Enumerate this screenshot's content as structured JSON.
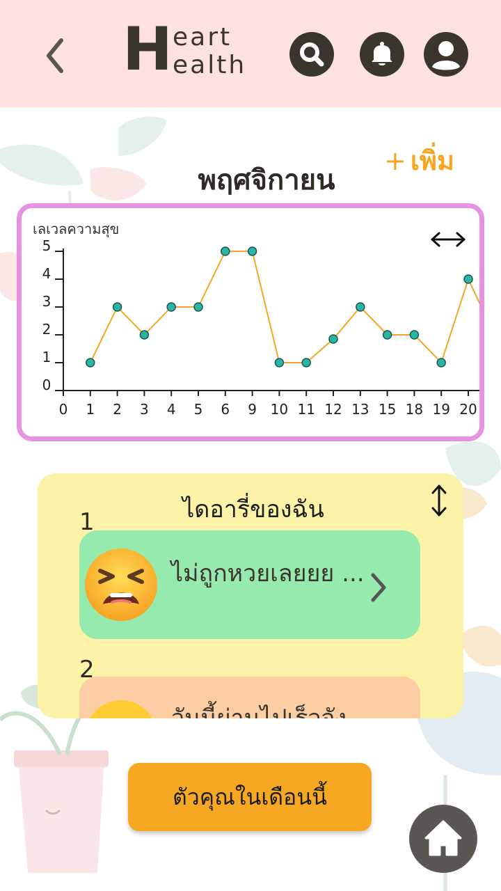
{
  "header": {
    "logo_letter": "H",
    "logo_word1": "eart",
    "logo_word2": "ealth",
    "icons": [
      "back-icon",
      "search-icon",
      "bell-icon",
      "user-icon"
    ]
  },
  "page": {
    "month": "พฤศจิกายน",
    "add_label": "เพิ่ม",
    "add_plus": "+"
  },
  "colors": {
    "header_bg": "#fde2dd",
    "accent": "#f7a623",
    "chart_border": "#e793e2",
    "line": "#f7a623",
    "point": "#2bb3a3",
    "diary_bg": "#fcf3a8",
    "entry1_bg": "#96eaae",
    "entry2_bg": "#fdcda4"
  },
  "chart_data": {
    "type": "line",
    "ylabel": "เลเวลความสุข",
    "x_ticks": [
      "0",
      "1",
      "2",
      "3",
      "4",
      "5",
      "6",
      "9",
      "10",
      "11",
      "12",
      "13",
      "15",
      "18",
      "19",
      "20"
    ],
    "y_ticks": [
      "0",
      "1",
      "2",
      "3",
      "4",
      "5"
    ],
    "ylim": [
      0,
      5
    ],
    "series": [
      {
        "x": [
          "1",
          "2",
          "3",
          "4",
          "5",
          "6",
          "9",
          "10",
          "11",
          "12",
          "13",
          "15",
          "18",
          "19",
          "20"
        ],
        "values": [
          1,
          3,
          2,
          3,
          3,
          5,
          5,
          1,
          1,
          1.85,
          3,
          2,
          2,
          1,
          4
        ]
      }
    ],
    "grid": false
  },
  "diary": {
    "title": "ไดอารี่ของฉัน",
    "entries": [
      {
        "number": "1",
        "text": "ไม่ถูกหวยเลยยย ...",
        "emoji": "tired-face-emoji"
      },
      {
        "number": "2",
        "text": "วันนี้ผ่านไปเร็วจัง",
        "emoji": "grinning-face-emoji"
      }
    ]
  },
  "footer": {
    "month_button": "ตัวคุณในเดือนนี้",
    "home_icon": "home-icon"
  }
}
